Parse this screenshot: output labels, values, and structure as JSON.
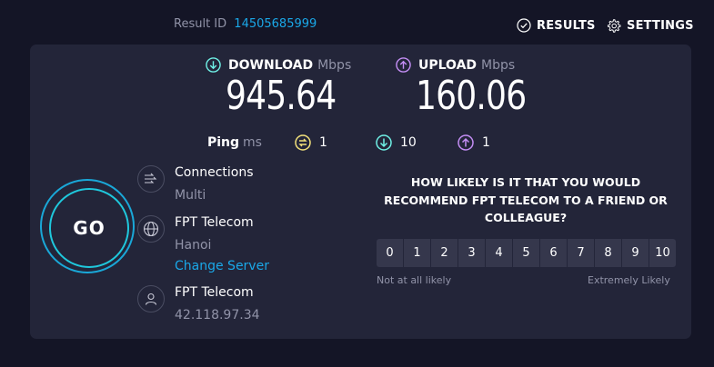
{
  "header": {
    "result_id_label": "Result ID",
    "result_id_value": "14505685999",
    "results_label": "RESULTS",
    "settings_label": "SETTINGS"
  },
  "download": {
    "label": "DOWNLOAD",
    "unit": "Mbps",
    "value": "945.64",
    "icon": "arrow-down-circle-icon",
    "color": "#6ff0e6"
  },
  "upload": {
    "label": "UPLOAD",
    "unit": "Mbps",
    "value": "160.06",
    "icon": "arrow-up-circle-icon",
    "color": "#c48ef5"
  },
  "ping": {
    "label": "Ping",
    "unit": "ms",
    "idle": "1",
    "download": "10",
    "upload": "1",
    "idle_color": "#f4e27b",
    "download_color": "#6ff0e6",
    "upload_color": "#c48ef5"
  },
  "go_button": {
    "label": "GO",
    "accent": "#1fc8dc"
  },
  "connections": {
    "title": "Connections",
    "value": "Multi"
  },
  "server": {
    "name": "FPT Telecom",
    "location": "Hanoi",
    "change_label": "Change Server"
  },
  "client": {
    "isp": "FPT Telecom",
    "ip": "42.118.97.34"
  },
  "survey": {
    "question": "HOW LIKELY IS IT THAT YOU WOULD RECOMMEND FPT TELECOM TO A FRIEND OR COLLEAGUE?",
    "options": [
      "0",
      "1",
      "2",
      "3",
      "4",
      "5",
      "6",
      "7",
      "8",
      "9",
      "10"
    ],
    "low_label": "Not at all likely",
    "high_label": "Extremely Likely"
  },
  "colors": {
    "background": "#141526",
    "panel": "#232539",
    "link": "#1aa8e8"
  }
}
